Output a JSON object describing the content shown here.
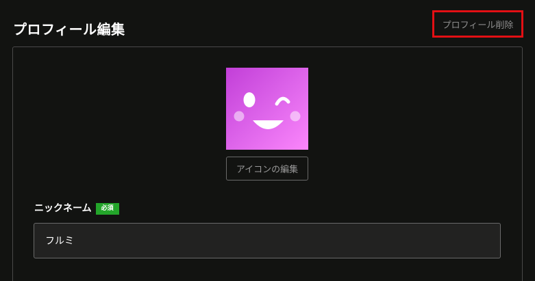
{
  "header": {
    "title": "プロフィール編集",
    "delete_label": "プロフィール削除"
  },
  "profile": {
    "avatar_icon": "winking-smile-face-icon",
    "avatar_colors": [
      "#c23fd8",
      "#fb86fb"
    ],
    "edit_icon_label": "アイコンの編集"
  },
  "nickname": {
    "label": "ニックネーム",
    "required_label": "必須",
    "value": "フルミ"
  },
  "colors": {
    "background": "#121311",
    "delete_highlight": "#e30f14",
    "required_badge": "#23a52a",
    "input_bg": "#222221"
  }
}
